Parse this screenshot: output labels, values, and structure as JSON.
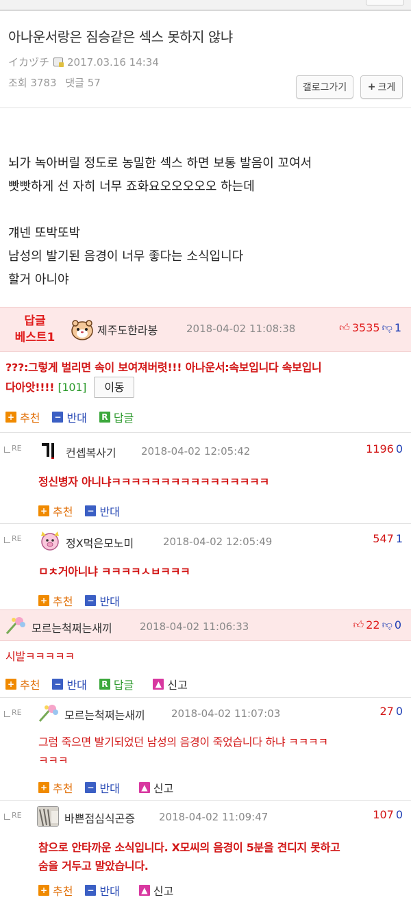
{
  "post": {
    "title": "아나운서랑은 짐승같은 섹스 못하지 않냐",
    "author": "イカヅチ",
    "datetime": "2017.03.16 14:34",
    "views_label": "조회 3783",
    "comments_label": "댓글 57",
    "gallery_button": "갤로그가기",
    "big_button": "크게",
    "body": [
      "뇌가 녹아버릴 정도로 농밀한 섹스 하면 보통 발음이 꼬여서",
      "빳빳하게 선 자히 너무 죠화요오오오오오 하는데",
      "",
      "걔넨 또박또박",
      "남성의 발기된 음경이 너무 좋다는 소식입니다",
      "할거 아니야"
    ]
  },
  "labels": {
    "best1": "답글",
    "best2": "베스트1",
    "recommend": "추천",
    "oppose": "반대",
    "reply": "답글",
    "report": "신고",
    "move": "이동",
    "re": "RE"
  },
  "comments": {
    "best": {
      "nick": "제주도한라봉",
      "date": "2018-04-02 11:08:38",
      "up": "3535",
      "down": "1",
      "text_line1": "???:그렇게 벌리면 속이 보여져버렷!!! 아나운서:속보입니다 속보입니",
      "text_line2": "다아앗!!!!",
      "count": "[101]"
    },
    "r1": {
      "nick": "컨셉복사기",
      "date": "2018-04-02 12:05:42",
      "up": "1196",
      "down": "0",
      "text": "정신병자 아니냐ㅋㅋㅋㅋㅋㅋㅋㅋㅋㅋㅋㅋㅋㅋㅋㅋ"
    },
    "r2": {
      "nick": "정X먹은모노미",
      "date": "2018-04-02 12:05:49",
      "up": "547",
      "down": "1",
      "text": "ㅁㅊ거아니냐 ㅋㅋㅋㅋㅅㅂㅋㅋㅋ"
    },
    "c2": {
      "nick": "모르는척쩌는새끼",
      "date": "2018-04-02 11:06:33",
      "up": "22",
      "down": "0",
      "text": "시발ㅋㅋㅋㅋㅋ"
    },
    "r3": {
      "nick": "모르는척쩌는새끼",
      "date": "2018-04-02 11:07:03",
      "up": "27",
      "down": "0",
      "text_line1": "그럼 죽으면 발기되었던 남성의 음경이 죽었습니다 하냐 ㅋㅋㅋㅋ",
      "text_line2": "ㅋㅋㅋ"
    },
    "r4": {
      "nick": "바쁜점심식곤증",
      "date": "2018-04-02 11:09:47",
      "up": "107",
      "down": "0",
      "text_line1": "참으로 안타까운 소식입니다. X모씨의 음경이 5분을 견디지 못하고",
      "text_line2": "숨을 거두고 말았습니다."
    }
  }
}
